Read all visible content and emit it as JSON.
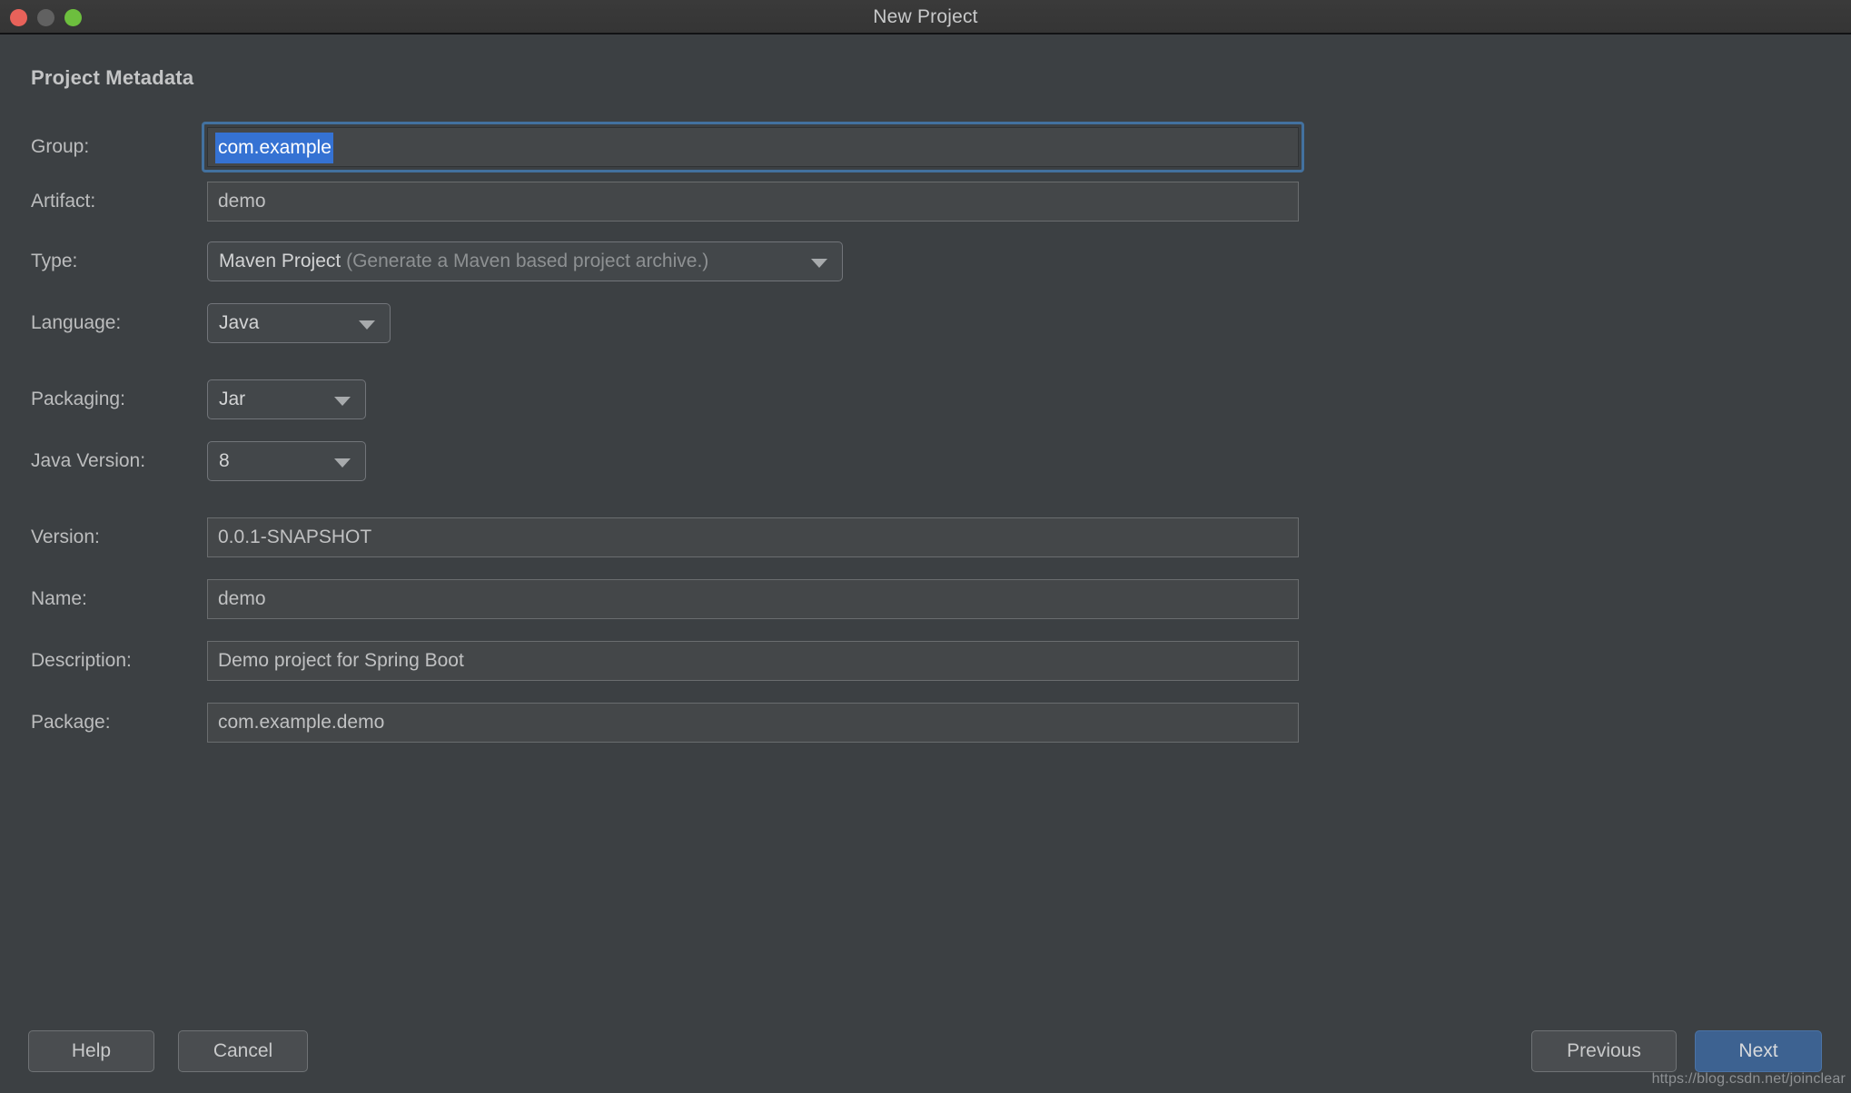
{
  "window": {
    "title": "New Project",
    "traffic_lights": [
      {
        "name": "close",
        "color": "#e8625a"
      },
      {
        "name": "minimize",
        "color": "#616161"
      },
      {
        "name": "zoom",
        "color": "#6dbf3e"
      }
    ]
  },
  "section": {
    "title": "Project Metadata"
  },
  "fields": {
    "group": {
      "label": "Group:",
      "value": "com.example",
      "selected": true,
      "focused": true
    },
    "artifact": {
      "label": "Artifact:",
      "value": "demo"
    },
    "type": {
      "label": "Type:",
      "value": "Maven Project",
      "hint": "(Generate a Maven based project archive.)",
      "icon": "chevron-down-icon"
    },
    "language": {
      "label": "Language:",
      "value": "Java",
      "icon": "chevron-down-icon"
    },
    "packaging": {
      "label": "Packaging:",
      "value": "Jar",
      "icon": "chevron-down-icon"
    },
    "java_version": {
      "label": "Java Version:",
      "value": "8",
      "icon": "chevron-down-icon"
    },
    "version": {
      "label": "Version:",
      "value": "0.0.1-SNAPSHOT"
    },
    "name": {
      "label": "Name:",
      "value": "demo"
    },
    "description": {
      "label": "Description:",
      "value": "Demo project for Spring Boot"
    },
    "package": {
      "label": "Package:",
      "value": "com.example.demo"
    }
  },
  "footer": {
    "help": "Help",
    "cancel": "Cancel",
    "previous": "Previous",
    "next": "Next"
  },
  "watermark": "https://blog.csdn.net/joinclear",
  "colors": {
    "window_background": "#3c4043",
    "titlebar": "#373737",
    "field_background": "#444749",
    "focus_ring": "#43719f",
    "selection": "#3572d3",
    "primary_button": "#3d6291",
    "text": "#c0c1c2",
    "muted_text": "#8e9193"
  }
}
